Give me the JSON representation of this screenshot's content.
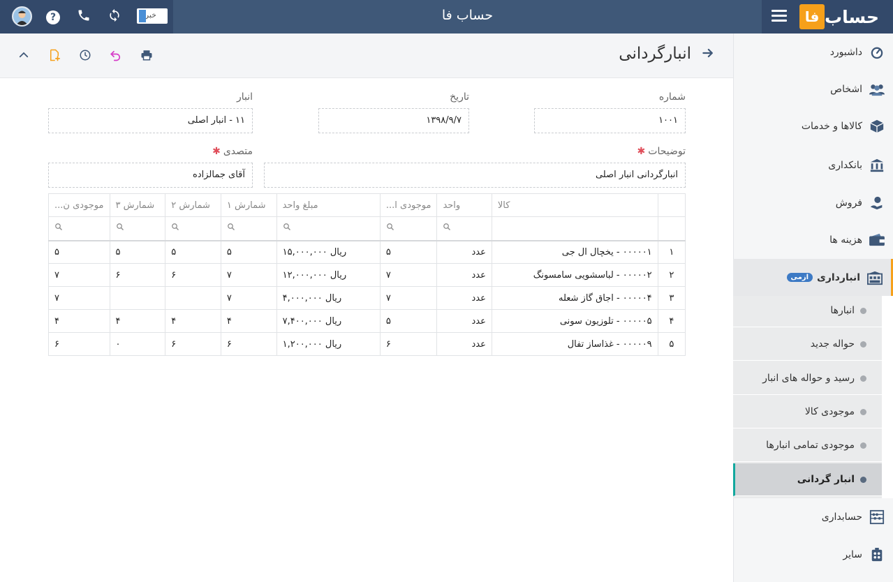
{
  "app": {
    "title": "حساب فا",
    "logo_text": "حساب",
    "logo_mark": "فا"
  },
  "topbar": {
    "news_label": "خبر",
    "help": "?"
  },
  "page": {
    "title": "انبارگردانی"
  },
  "form": {
    "number_label": "شماره",
    "number_value": "۱۰۰۱",
    "date_label": "تاریخ",
    "date_value": "۱۳۹۸/۹/۷",
    "warehouse_label": "انبار",
    "warehouse_value": "۱۱ - انبار اصلی",
    "desc_label": "توضیحات",
    "desc_value": "انبارگردانی انبار اصلی",
    "person_label": "متصدی",
    "person_value": "آقای جمالزاده",
    "required_mark": "✱"
  },
  "table": {
    "headers": {
      "row": "",
      "kala": "کالا",
      "unit": "واحد",
      "stock": "موجودی ا...",
      "price": "مبلغ واحد",
      "c1": "شمارش ۱",
      "c2": "شمارش ۲",
      "c3": "شمارش ۳",
      "final": "موجودی ن..."
    },
    "rows": [
      {
        "n": "۱",
        "kala": "۰۰۰۰۰۱ - یخچال ال جی",
        "unit": "عدد",
        "stock": "۵",
        "price": "ریال ۱۵,۰۰۰,۰۰۰",
        "c1": "۵",
        "c2": "۵",
        "c3": "۵",
        "final": "۵"
      },
      {
        "n": "۲",
        "kala": "۰۰۰۰۰۲ - لباسشویی سامسونگ",
        "unit": "عدد",
        "stock": "۷",
        "price": "ریال ۱۲,۰۰۰,۰۰۰",
        "c1": "۷",
        "c2": "۶",
        "c3": "۶",
        "final": "۷"
      },
      {
        "n": "۳",
        "kala": "۰۰۰۰۰۴ - اجاق گاز شعله",
        "unit": "عدد",
        "stock": "۷",
        "price": "ریال ۴,۰۰۰,۰۰۰",
        "c1": "۷",
        "c2": "",
        "c3": "",
        "final": "۷"
      },
      {
        "n": "۴",
        "kala": "۰۰۰۰۰۵ - تلوزیون سونی",
        "unit": "عدد",
        "stock": "۵",
        "price": "ریال ۷,۴۰۰,۰۰۰",
        "c1": "۴",
        "c2": "۴",
        "c3": "۴",
        "final": "۴"
      },
      {
        "n": "۵",
        "kala": "۰۰۰۰۰۹ - غذاساز تفال",
        "unit": "عدد",
        "stock": "۶",
        "price": "ریال ۱,۲۰۰,۰۰۰",
        "c1": "۶",
        "c2": "۶",
        "c3": "۰",
        "final": "۶"
      }
    ]
  },
  "sidebar": {
    "items": [
      {
        "label": "داشبورد",
        "icon": "dashboard-icon"
      },
      {
        "label": "اشخاص",
        "icon": "people-icon"
      },
      {
        "label": "کالاها و خدمات",
        "icon": "box-icon"
      },
      {
        "label": "بانکداری",
        "icon": "bank-icon"
      },
      {
        "label": "فروش",
        "icon": "sales-icon"
      },
      {
        "label": "هزینه ها",
        "icon": "wallet-icon"
      },
      {
        "label": "انبارداری",
        "icon": "warehouse-icon",
        "badge": "ازمی"
      },
      {
        "label": "حسابداری",
        "icon": "abacus-icon"
      },
      {
        "label": "سایر",
        "icon": "other-icon"
      }
    ],
    "sub_items": [
      {
        "label": "انبارها"
      },
      {
        "label": "حواله جدید"
      },
      {
        "label": "رسید و حواله های انبار"
      },
      {
        "label": "موجودی کالا"
      },
      {
        "label": "موجودی تمامی انبارها"
      },
      {
        "label": "انبار گردانی"
      }
    ]
  },
  "colors": {
    "topbar": "#3f5878",
    "accent": "#f6a01a",
    "active_border": "#13a89e",
    "required": "#e04e5a"
  }
}
